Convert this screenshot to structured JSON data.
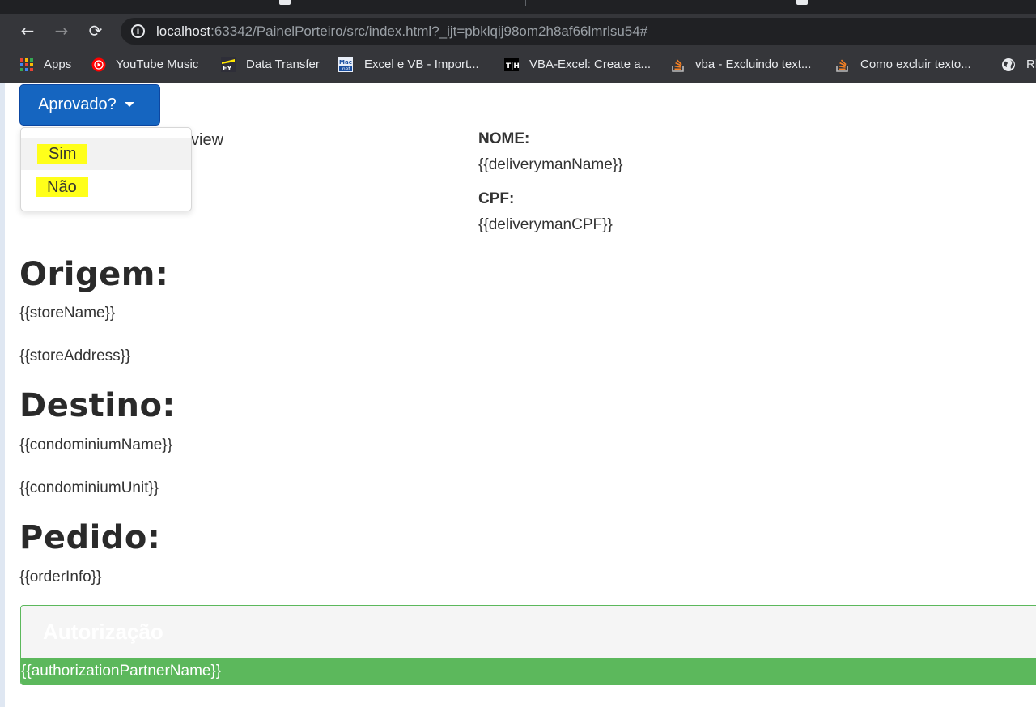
{
  "browser": {
    "url_host": "localhost",
    "url_rest": ":63342/PainelPorteiro/src/index.html?_ijt=pbklqij98om2h8af66lmrlsu54#",
    "bookmarks": [
      {
        "label": "Apps",
        "icon": "apps-grid-icon"
      },
      {
        "label": "YouTube Music",
        "icon": "youtube-music-icon"
      },
      {
        "label": "Data Transfer",
        "icon": "ey-icon"
      },
      {
        "label": "Excel e VB - Import...",
        "icon": "macoratti-icon"
      },
      {
        "label": "VBA-Excel: Create a...",
        "icon": "th-icon"
      },
      {
        "label": "vba - Excluindo text...",
        "icon": "stackoverflow-icon"
      },
      {
        "label": "Como excluir texto...",
        "icon": "stackoverflow-icon"
      },
      {
        "label": "Rl",
        "icon": "globe-icon"
      }
    ]
  },
  "dropdown": {
    "label": "Aprovado?",
    "items": [
      "Sim",
      "Não"
    ],
    "hidden_text": "view"
  },
  "deliveryman": {
    "name_label": "NOME:",
    "name_value": "{{deliverymanName}}",
    "cpf_label": "CPF:",
    "cpf_value": "{{deliverymanCPF}}"
  },
  "origem": {
    "title": "Origem:",
    "store_name": "{{storeName}}",
    "store_address": "{{storeAddress}}"
  },
  "destino": {
    "title": "Destino:",
    "condominium_name": "{{condominiumName}}",
    "condominium_unit": "{{condominiumUnit}}"
  },
  "pedido": {
    "title": "Pedido:",
    "order_info": "{{orderInfo}}"
  },
  "autorizacao": {
    "header": "Autorização",
    "partner_name": "{{authorizationPartnerName}}"
  },
  "colors": {
    "primary": "#1565c0",
    "success": "#5cb85c",
    "highlight": "#ffff1a"
  }
}
